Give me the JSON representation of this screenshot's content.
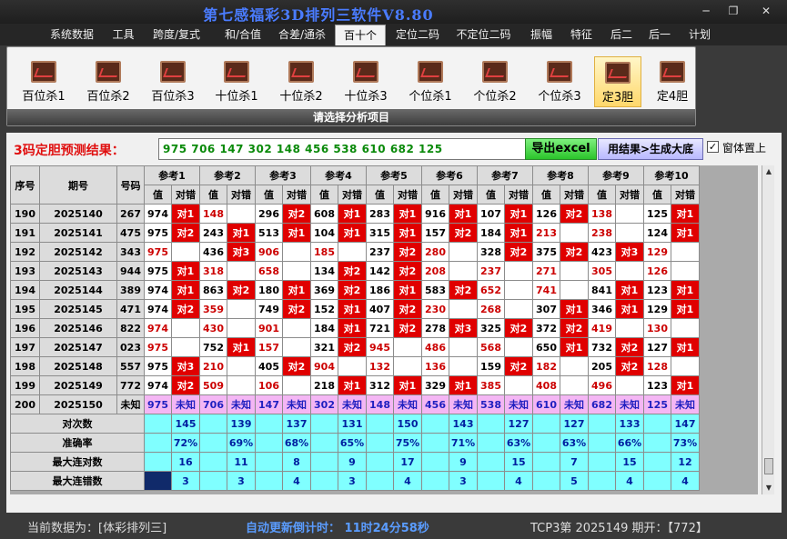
{
  "window": {
    "title": "第七感福彩3D排列三软件V8.80",
    "minimize": "─",
    "maximize": "❐",
    "close": "✕"
  },
  "menu": [
    "系统数据",
    "工具",
    "跨度/复式",
    "和/合值",
    "合差/通杀",
    "百十个",
    "定位二码",
    "不定位二码",
    "振幅",
    "特征",
    "后二",
    "后一",
    "计划"
  ],
  "menu_active": "百十个",
  "ribbon": {
    "buttons": [
      "百位杀1",
      "百位杀2",
      "百位杀3",
      "十位杀1",
      "十位杀2",
      "十位杀3",
      "个位杀1",
      "个位杀2",
      "个位杀3",
      "定3胆",
      "定4胆"
    ],
    "selected": "定3胆",
    "caption": "请选择分析项目"
  },
  "result": {
    "label": "3码定胆预测结果：",
    "value": "975 706 147 302 148 456 538 610 682 125",
    "excel_button": "导出excel",
    "dadi_button": "用结果>生成大底",
    "topmost_label": "窗体置上",
    "topmost_checked": "✓"
  },
  "table": {
    "headers": {
      "seq": "序号",
      "period": "期号",
      "number": "号码",
      "refs": [
        "参考1",
        "参考2",
        "参考3",
        "参考4",
        "参考5",
        "参考6",
        "参考7",
        "参考8",
        "参考9",
        "参考10"
      ],
      "val": "值",
      "check": "对错"
    },
    "rows": [
      {
        "seq": "190",
        "period": "2025140",
        "number": "267",
        "cells": [
          [
            "974",
            "对1",
            1,
            0
          ],
          [
            "148",
            "",
            0,
            1
          ],
          [
            "296",
            "对2",
            1,
            0
          ],
          [
            "608",
            "对1",
            1,
            0
          ],
          [
            "283",
            "对1",
            1,
            0
          ],
          [
            "916",
            "对1",
            1,
            0
          ],
          [
            "107",
            "对1",
            1,
            0
          ],
          [
            "126",
            "对2",
            1,
            0
          ],
          [
            "138",
            "",
            0,
            1
          ],
          [
            "125",
            "对1",
            1,
            0
          ]
        ]
      },
      {
        "seq": "191",
        "period": "2025141",
        "number": "475",
        "cells": [
          [
            "975",
            "对2",
            1,
            0
          ],
          [
            "243",
            "对1",
            1,
            0
          ],
          [
            "513",
            "对1",
            1,
            0
          ],
          [
            "104",
            "对1",
            1,
            0
          ],
          [
            "315",
            "对1",
            1,
            0
          ],
          [
            "157",
            "对2",
            1,
            0
          ],
          [
            "184",
            "对1",
            1,
            0
          ],
          [
            "213",
            "",
            0,
            1
          ],
          [
            "238",
            "",
            0,
            1
          ],
          [
            "124",
            "对1",
            1,
            0
          ]
        ]
      },
      {
        "seq": "192",
        "period": "2025142",
        "number": "343",
        "cells": [
          [
            "975",
            "",
            0,
            1
          ],
          [
            "436",
            "对3",
            1,
            0
          ],
          [
            "906",
            "",
            0,
            1
          ],
          [
            "185",
            "",
            0,
            1
          ],
          [
            "237",
            "对2",
            1,
            0
          ],
          [
            "280",
            "",
            0,
            1
          ],
          [
            "328",
            "对2",
            1,
            0
          ],
          [
            "375",
            "对2",
            1,
            0
          ],
          [
            "423",
            "对3",
            1,
            0
          ],
          [
            "129",
            "",
            0,
            1
          ]
        ]
      },
      {
        "seq": "193",
        "period": "2025143",
        "number": "944",
        "cells": [
          [
            "975",
            "对1",
            1,
            0
          ],
          [
            "318",
            "",
            0,
            1
          ],
          [
            "658",
            "",
            0,
            1
          ],
          [
            "134",
            "对2",
            1,
            0
          ],
          [
            "142",
            "对2",
            1,
            0
          ],
          [
            "208",
            "",
            0,
            1
          ],
          [
            "237",
            "",
            0,
            1
          ],
          [
            "271",
            "",
            0,
            1
          ],
          [
            "305",
            "",
            0,
            1
          ],
          [
            "126",
            "",
            0,
            1
          ]
        ]
      },
      {
        "seq": "194",
        "period": "2025144",
        "number": "389",
        "cells": [
          [
            "974",
            "对1",
            1,
            0
          ],
          [
            "863",
            "对2",
            1,
            0
          ],
          [
            "180",
            "对1",
            1,
            0
          ],
          [
            "369",
            "对2",
            1,
            0
          ],
          [
            "186",
            "对1",
            1,
            0
          ],
          [
            "583",
            "对2",
            1,
            0
          ],
          [
            "652",
            "",
            0,
            1
          ],
          [
            "741",
            "",
            0,
            1
          ],
          [
            "841",
            "对1",
            1,
            0
          ],
          [
            "123",
            "对1",
            1,
            0
          ]
        ]
      },
      {
        "seq": "195",
        "period": "2025145",
        "number": "471",
        "cells": [
          [
            "974",
            "对2",
            1,
            0
          ],
          [
            "359",
            "",
            0,
            1
          ],
          [
            "749",
            "对2",
            1,
            0
          ],
          [
            "152",
            "对1",
            1,
            0
          ],
          [
            "407",
            "对2",
            1,
            0
          ],
          [
            "230",
            "",
            0,
            1
          ],
          [
            "268",
            "",
            0,
            1
          ],
          [
            "307",
            "对1",
            1,
            0
          ],
          [
            "346",
            "对1",
            1,
            0
          ],
          [
            "129",
            "对1",
            1,
            0
          ]
        ]
      },
      {
        "seq": "196",
        "period": "2025146",
        "number": "822",
        "cells": [
          [
            "974",
            "",
            0,
            1
          ],
          [
            "430",
            "",
            0,
            1
          ],
          [
            "901",
            "",
            0,
            1
          ],
          [
            "184",
            "对1",
            1,
            0
          ],
          [
            "721",
            "对2",
            1,
            0
          ],
          [
            "278",
            "对3",
            1,
            0
          ],
          [
            "325",
            "对2",
            1,
            0
          ],
          [
            "372",
            "对2",
            1,
            0
          ],
          [
            "419",
            "",
            0,
            1
          ],
          [
            "130",
            "",
            0,
            1
          ]
        ]
      },
      {
        "seq": "197",
        "period": "2025147",
        "number": "023",
        "cells": [
          [
            "975",
            "",
            0,
            1
          ],
          [
            "752",
            "对1",
            1,
            0
          ],
          [
            "157",
            "",
            0,
            1
          ],
          [
            "321",
            "对2",
            1,
            0
          ],
          [
            "945",
            "",
            0,
            1
          ],
          [
            "486",
            "",
            0,
            1
          ],
          [
            "568",
            "",
            0,
            1
          ],
          [
            "650",
            "对1",
            1,
            0
          ],
          [
            "732",
            "对2",
            1,
            0
          ],
          [
            "127",
            "对1",
            1,
            0
          ]
        ]
      },
      {
        "seq": "198",
        "period": "2025148",
        "number": "557",
        "cells": [
          [
            "975",
            "对3",
            1,
            0
          ],
          [
            "210",
            "",
            0,
            1
          ],
          [
            "405",
            "对2",
            1,
            0
          ],
          [
            "904",
            "",
            0,
            1
          ],
          [
            "132",
            "",
            0,
            1
          ],
          [
            "136",
            "",
            0,
            1
          ],
          [
            "159",
            "对2",
            1,
            0
          ],
          [
            "182",
            "",
            0,
            1
          ],
          [
            "205",
            "对2",
            1,
            0
          ],
          [
            "128",
            "",
            0,
            1
          ]
        ]
      },
      {
        "seq": "199",
        "period": "2025149",
        "number": "772",
        "cells": [
          [
            "974",
            "对2",
            1,
            0
          ],
          [
            "509",
            "",
            0,
            1
          ],
          [
            "106",
            "",
            0,
            1
          ],
          [
            "218",
            "对1",
            1,
            0
          ],
          [
            "312",
            "对1",
            1,
            0
          ],
          [
            "329",
            "对1",
            1,
            0
          ],
          [
            "385",
            "",
            0,
            1
          ],
          [
            "408",
            "",
            0,
            1
          ],
          [
            "496",
            "",
            0,
            1
          ],
          [
            "123",
            "对1",
            1,
            0
          ]
        ]
      }
    ],
    "pending": {
      "seq": "200",
      "period": "2025150",
      "number": "未知",
      "values": [
        "975",
        "706",
        "147",
        "302",
        "148",
        "456",
        "538",
        "610",
        "682",
        "125"
      ],
      "status": "未知"
    },
    "stats": [
      {
        "label": "对次数",
        "values": [
          "145",
          "139",
          "137",
          "131",
          "150",
          "143",
          "127",
          "127",
          "133",
          "147"
        ]
      },
      {
        "label": "准确率",
        "values": [
          "72%",
          "69%",
          "68%",
          "65%",
          "75%",
          "71%",
          "63%",
          "63%",
          "66%",
          "73%"
        ]
      },
      {
        "label": "最大连对数",
        "values": [
          "16",
          "11",
          "8",
          "9",
          "17",
          "9",
          "15",
          "7",
          "15",
          "12"
        ]
      },
      {
        "label": "最大连错数",
        "values": [
          "3",
          "3",
          "4",
          "3",
          "4",
          "3",
          "4",
          "5",
          "4",
          "4"
        ]
      }
    ]
  },
  "scroll": {
    "up": "▲",
    "down": "▼"
  },
  "status": {
    "data_source": "当前数据为：[体彩排列三]",
    "countdown": "自动更新倒计时： 11时24分58秒",
    "tcp": "TCP3第 2025149 期开：【772】"
  },
  "colors": {
    "hit": "#e00000",
    "miss_text": "#cc0000",
    "pending_row": "#f4b6f4",
    "stats": "#80ffff",
    "title": "#4a7cff"
  }
}
